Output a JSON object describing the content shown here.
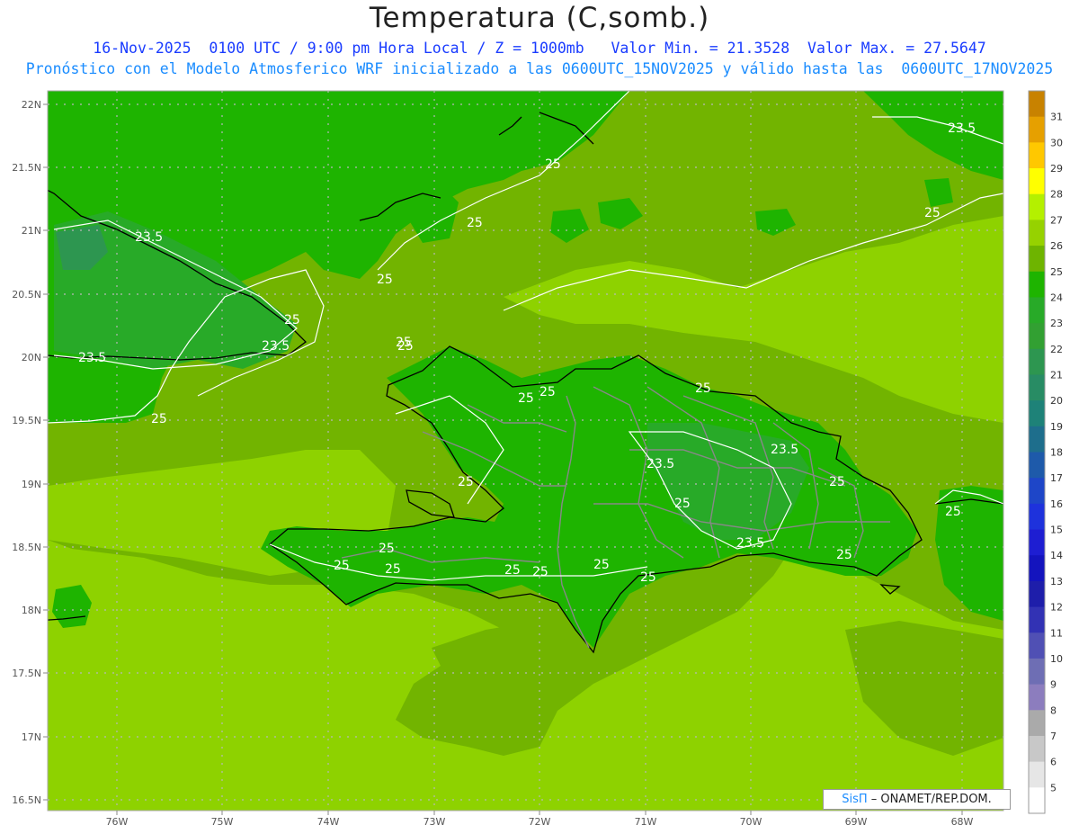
{
  "header": {
    "title": "Temperatura (C,somb.)",
    "line1": "16-Nov-2025  0100 UTC / 9:00 pm Hora Local / Z = 1000mb   Valor Min. = 21.3528  Valor Max. = 27.5647",
    "line2": "Pronóstico con el Modelo Atmosferico WRF inicializado a las 0600UTC_15NOV2025 y válido hasta las  0600UTC_17NOV2025"
  },
  "axes": {
    "lat_labels": [
      "22N",
      "21.5N",
      "21N",
      "20.5N",
      "20N",
      "19.5N",
      "19N",
      "18.5N",
      "18N",
      "17.5N",
      "17N",
      "16.5N"
    ],
    "lon_labels": [
      "76W",
      "75W",
      "74W",
      "73W",
      "72W",
      "71W",
      "70W",
      "69W",
      "68W"
    ]
  },
  "colorbar": {
    "labels": [
      "31",
      "30",
      "29",
      "28",
      "27",
      "26",
      "25",
      "24",
      "23",
      "22",
      "21",
      "20",
      "19",
      "18",
      "17",
      "16",
      "15",
      "14",
      "13",
      "12",
      "11",
      "10",
      "9",
      "8",
      "7",
      "6",
      "5"
    ],
    "colors": [
      "#c88200",
      "#e6a000",
      "#ffc800",
      "#ffff00",
      "#b4f000",
      "#96d200",
      "#6eb400",
      "#1eb400",
      "#28aa28",
      "#32a032",
      "#2d9650",
      "#288c64",
      "#1e8278",
      "#1e6e8c",
      "#1e5aaa",
      "#1e46c8",
      "#1e32dc",
      "#1e1ed2",
      "#1414be",
      "#1e1eaa",
      "#3232b4",
      "#5050b4",
      "#6e6eb4",
      "#8c7dbe",
      "#aaaaaa",
      "#c8c8c8",
      "#e6e6e6",
      "#ffffff"
    ]
  },
  "contour_labels": [
    "25",
    "23.5",
    "25",
    "25",
    "25",
    "23.5",
    "25",
    "23.5",
    "25",
    "23.5",
    "25",
    "25",
    "25",
    "23.5",
    "23.5",
    "25",
    "25",
    "25",
    "25",
    "25",
    "25",
    "25",
    "25",
    "25",
    "25",
    "25",
    "23.5",
    "25",
    "25",
    "25"
  ],
  "credit": {
    "brand": "SisΠ",
    "text": " – ONAMET/REP.DOM."
  }
}
